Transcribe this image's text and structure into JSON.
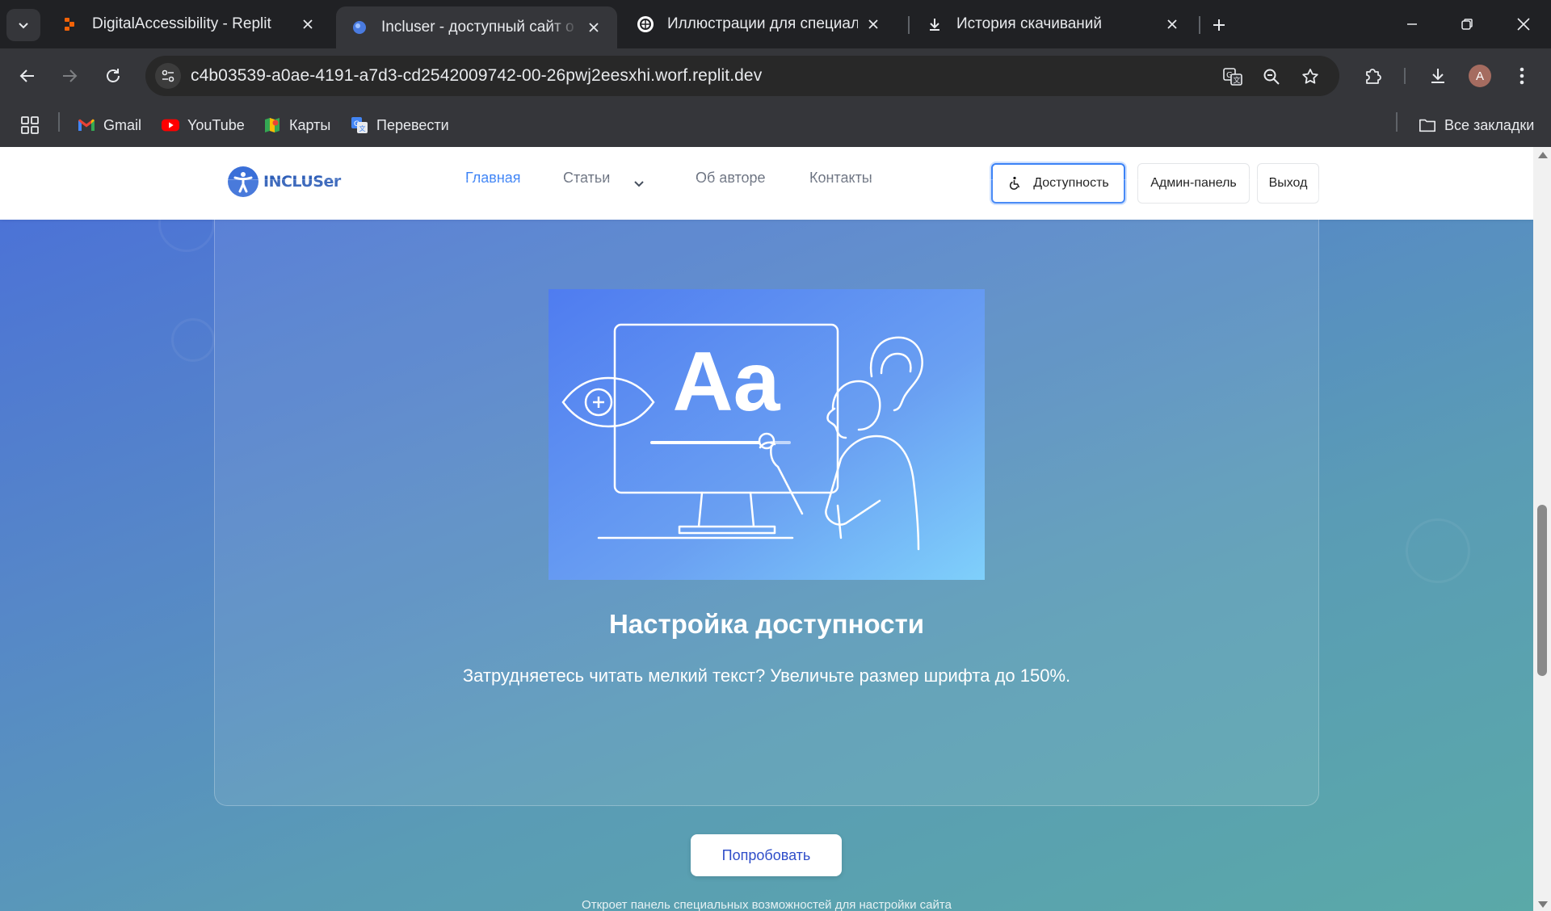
{
  "browser": {
    "tabs": [
      {
        "title": "DigitalAccessibility - Replit",
        "active": false
      },
      {
        "title": "Incluser - доступный сайт о доступности",
        "active": true
      },
      {
        "title": "Иллюстрации для специальных возможностей",
        "active": false
      },
      {
        "title": "История скачиваний",
        "active": false
      }
    ],
    "url": "c4b03539-a0ae-4191-a7d3-cd2542009742-00-26pwj2eesxhi.worf.replit.dev",
    "profile_initial": "A",
    "bookmarks": [
      {
        "label": "Gmail",
        "icon": "gmail-icon"
      },
      {
        "label": "YouTube",
        "icon": "youtube-icon"
      },
      {
        "label": "Карты",
        "icon": "maps-icon"
      },
      {
        "label": "Перевести",
        "icon": "translate-icon"
      }
    ],
    "all_bookmarks_label": "Все закладки"
  },
  "site": {
    "logo_text": "INCLUSer",
    "nav": {
      "home": "Главная",
      "articles": "Статьи",
      "about": "Об авторе",
      "contacts": "Контакты"
    },
    "buttons": {
      "accessibility": "Доступность",
      "admin": "Админ-панель",
      "logout": "Выход"
    },
    "slide": {
      "illustration_text": "Aa",
      "title": "Настройка доступности",
      "text": "Затрудняетесь читать мелкий текст? Увеличьте размер шрифта до 150%."
    },
    "cta": {
      "label": "Попробовать",
      "hint": "Откроет панель специальных возможностей для настройки сайта"
    }
  },
  "colors": {
    "accent": "#3b82f6",
    "cta_text": "#2f4ec9",
    "chrome_bg": "#202124",
    "toolbar_bg": "#35363a"
  }
}
